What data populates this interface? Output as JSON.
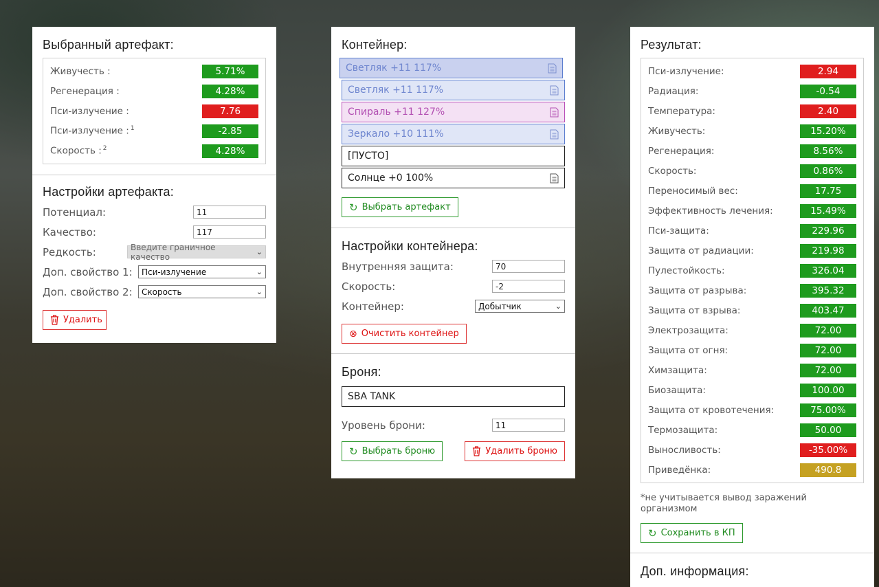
{
  "artifact": {
    "title": "Выбранный артефакт:",
    "stats": [
      {
        "label": "Живучесть :",
        "sup": "",
        "value": "5.71%",
        "color": "green"
      },
      {
        "label": "Регенерация :",
        "sup": "",
        "value": "4.28%",
        "color": "green"
      },
      {
        "label": "Пси-излучение :",
        "sup": "",
        "value": "7.76",
        "color": "red"
      },
      {
        "label": "Пси-излучение :",
        "sup": "1",
        "value": "-2.85",
        "color": "green"
      },
      {
        "label": "Скорость :",
        "sup": "2",
        "value": "4.28%",
        "color": "green"
      }
    ]
  },
  "artifact_settings": {
    "title": "Настройки артефакта:",
    "potential_label": "Потенциал:",
    "potential_value": "11",
    "quality_label": "Качество:",
    "quality_value": "117",
    "rarity_label": "Редкость:",
    "rarity_value": "Введите граничное качество",
    "extra1_label": "Доп. свойство 1:",
    "extra1_value": "Пси-излучение",
    "extra2_label": "Доп. свойство 2:",
    "extra2_value": "Скорость",
    "delete_label": "Удалить"
  },
  "container": {
    "title": "Контейнер:",
    "slots": [
      {
        "label": "Светляк +11 117%",
        "style": "blue-dark",
        "icon": true
      },
      {
        "label": "Светляк +11 117%",
        "style": "blue",
        "icon": true
      },
      {
        "label": "Спираль +11 127%",
        "style": "pink",
        "icon": true
      },
      {
        "label": "Зеркало +10 111%",
        "style": "blue",
        "icon": true
      },
      {
        "label": "[ПУСТО]",
        "style": "plain",
        "icon": false
      },
      {
        "label": "Солнце +0 100%",
        "style": "plain",
        "icon": true
      }
    ],
    "choose_label": "Выбрать артефакт"
  },
  "container_settings": {
    "title": "Настройки контейнера:",
    "protection_label": "Внутренняя защита:",
    "protection_value": "70",
    "speed_label": "Скорость:",
    "speed_value": "-2",
    "container_label": "Контейнер:",
    "container_value": "Добытчик",
    "clear_label": "Очистить контейнер"
  },
  "armor": {
    "title": "Броня:",
    "name": "SBA TANK",
    "level_label": "Уровень брони:",
    "level_value": "11",
    "choose_label": "Выбрать броню",
    "delete_label": "Удалить броню"
  },
  "result": {
    "title": "Результат:",
    "stats": [
      {
        "label": "Пси-излучение:",
        "value": "2.94",
        "color": "red"
      },
      {
        "label": "Радиация:",
        "value": "-0.54",
        "color": "green"
      },
      {
        "label": "Температура:",
        "value": "2.40",
        "color": "red"
      },
      {
        "label": "Живучесть:",
        "value": "15.20%",
        "color": "green"
      },
      {
        "label": "Регенерация:",
        "value": "8.56%",
        "color": "green"
      },
      {
        "label": "Скорость:",
        "value": "0.86%",
        "color": "green"
      },
      {
        "label": "Переносимый вес:",
        "value": "17.75",
        "color": "green"
      },
      {
        "label": "Эффективность лечения:",
        "value": "15.49%",
        "color": "green"
      },
      {
        "label": "Пси-защита:",
        "value": "229.96",
        "color": "green"
      },
      {
        "label": "Защита от радиации:",
        "value": "219.98",
        "color": "green"
      },
      {
        "label": "Пулестойкость:",
        "value": "326.04",
        "color": "green"
      },
      {
        "label": "Защита от разрыва:",
        "value": "395.32",
        "color": "green"
      },
      {
        "label": "Защита от взрыва:",
        "value": "403.47",
        "color": "green"
      },
      {
        "label": "Электрозащита:",
        "value": "72.00",
        "color": "green"
      },
      {
        "label": "Защита от огня:",
        "value": "72.00",
        "color": "green"
      },
      {
        "label": "Химзащита:",
        "value": "72.00",
        "color": "green"
      },
      {
        "label": "Биозащита:",
        "value": "100.00",
        "color": "green"
      },
      {
        "label": "Защита от кровотечения:",
        "value": "75.00%",
        "color": "green"
      },
      {
        "label": "Термозащита:",
        "value": "50.00",
        "color": "green"
      },
      {
        "label": "Выносливость:",
        "value": "-35.00%",
        "color": "red"
      },
      {
        "label": "Приведёнка:",
        "value": "490.8",
        "color": "gold"
      }
    ],
    "note": "*не учитывается вывод заражений организмом",
    "save_label": "Сохранить в КП"
  },
  "extra_info": {
    "title": "Доп. информация:"
  },
  "colors": {
    "green": "#1e9b1e",
    "red": "#e01e1e",
    "gold": "#c5a122"
  }
}
